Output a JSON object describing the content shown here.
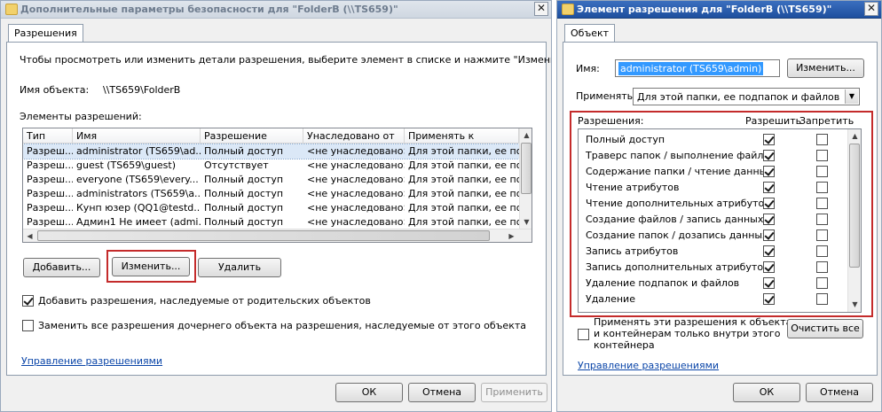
{
  "left_window": {
    "title": "Дополнительные параметры безопасности  для \"FolderB (\\\\TS659)\"",
    "close_glyph": "✕",
    "tab_label": "Разрешения",
    "instructions": "Чтобы просмотреть или изменить детали разрешения, выберите элемент в списке и нажмите \"Изменить\".",
    "object_name_label": "Имя объекта:",
    "object_name_value": "\\\\TS659\\FolderB",
    "entries_label": "Элементы разрешений:",
    "columns": [
      "Тип",
      "Имя",
      "Разрешение",
      "Унаследовано от",
      "Применять к"
    ],
    "rows": [
      [
        "Разреш...",
        "administrator (TS659\\ad...",
        "Полный доступ",
        "<не унаследовано>",
        "Для этой папки, ее под..."
      ],
      [
        "Разреш...",
        "guest (TS659\\guest)",
        "Отсутствует",
        "<не унаследовано>",
        "Для этой папки, ее под..."
      ],
      [
        "Разреш...",
        "everyone (TS659\\every...",
        "Полный доступ",
        "<не унаследовано>",
        "Для этой папки, ее под..."
      ],
      [
        "Разреш...",
        "administrators (TS659\\a...",
        "Полный доступ",
        "<не унаследовано>",
        "Для этой папки, ее под..."
      ],
      [
        "Разреш...",
        "Кунп юзер (QQ1@testd...",
        "Полный доступ",
        "<не унаследовано>",
        "Для этой папки, ее под..."
      ],
      [
        "Разреш...",
        "Админ1 Не имеет (admi...",
        "Полный доступ",
        "<не унаследовано>",
        "Для этой папки, ее под..."
      ]
    ],
    "add_label": "Добавить...",
    "change_label": "Изменить...",
    "delete_label": "Удалить",
    "inherit_checkbox_label": "Добавить разрешения, наследуемые от родительских объектов",
    "replace_checkbox_label": "Заменить все разрешения дочернего объекта на разрешения, наследуемые от этого объекта",
    "manage_link": "Управление разрешениями",
    "ok_label": "ОК",
    "cancel_label": "Отмена",
    "apply_label": "Применить"
  },
  "right_window": {
    "title": "Элемент разрешения для \"FolderB (\\\\TS659)\"",
    "close_glyph": "✕",
    "tab_label": "Объект",
    "name_label": "Имя:",
    "name_value": "administrator (TS659\\admin)",
    "change_label": "Изменить...",
    "apply_to_label": "Применять:",
    "apply_to_value": "Для этой папки, ее подпапок и файлов",
    "permissions_label": "Разрешения:",
    "allow_label": "Разрешить",
    "deny_label": "Запретить",
    "permissions": [
      {
        "name": "Полный доступ",
        "allow": true,
        "deny": false
      },
      {
        "name": "Траверс папок / выполнение файлов",
        "allow": true,
        "deny": false
      },
      {
        "name": "Содержание папки / чтение данных",
        "allow": true,
        "deny": false
      },
      {
        "name": "Чтение атрибутов",
        "allow": true,
        "deny": false
      },
      {
        "name": "Чтение дополнительных атрибутов",
        "allow": true,
        "deny": false
      },
      {
        "name": "Создание файлов / запись данных",
        "allow": true,
        "deny": false
      },
      {
        "name": "Создание папок / дозапись данных",
        "allow": true,
        "deny": false
      },
      {
        "name": "Запись атрибутов",
        "allow": true,
        "deny": false
      },
      {
        "name": "Запись дополнительных атрибутов",
        "allow": true,
        "deny": false
      },
      {
        "name": "Удаление подпапок и файлов",
        "allow": true,
        "deny": false
      },
      {
        "name": "Удаление",
        "allow": true,
        "deny": false
      }
    ],
    "apply_inside_line1": "Применять эти разрешения к объектам",
    "apply_inside_line2": "и контейнерам только внутри этого",
    "apply_inside_line3": "контейнера",
    "clear_all_label": "Очистить все",
    "manage_link": "Управление разрешениями",
    "ok_label": "ОК",
    "cancel_label": "Отмена"
  }
}
